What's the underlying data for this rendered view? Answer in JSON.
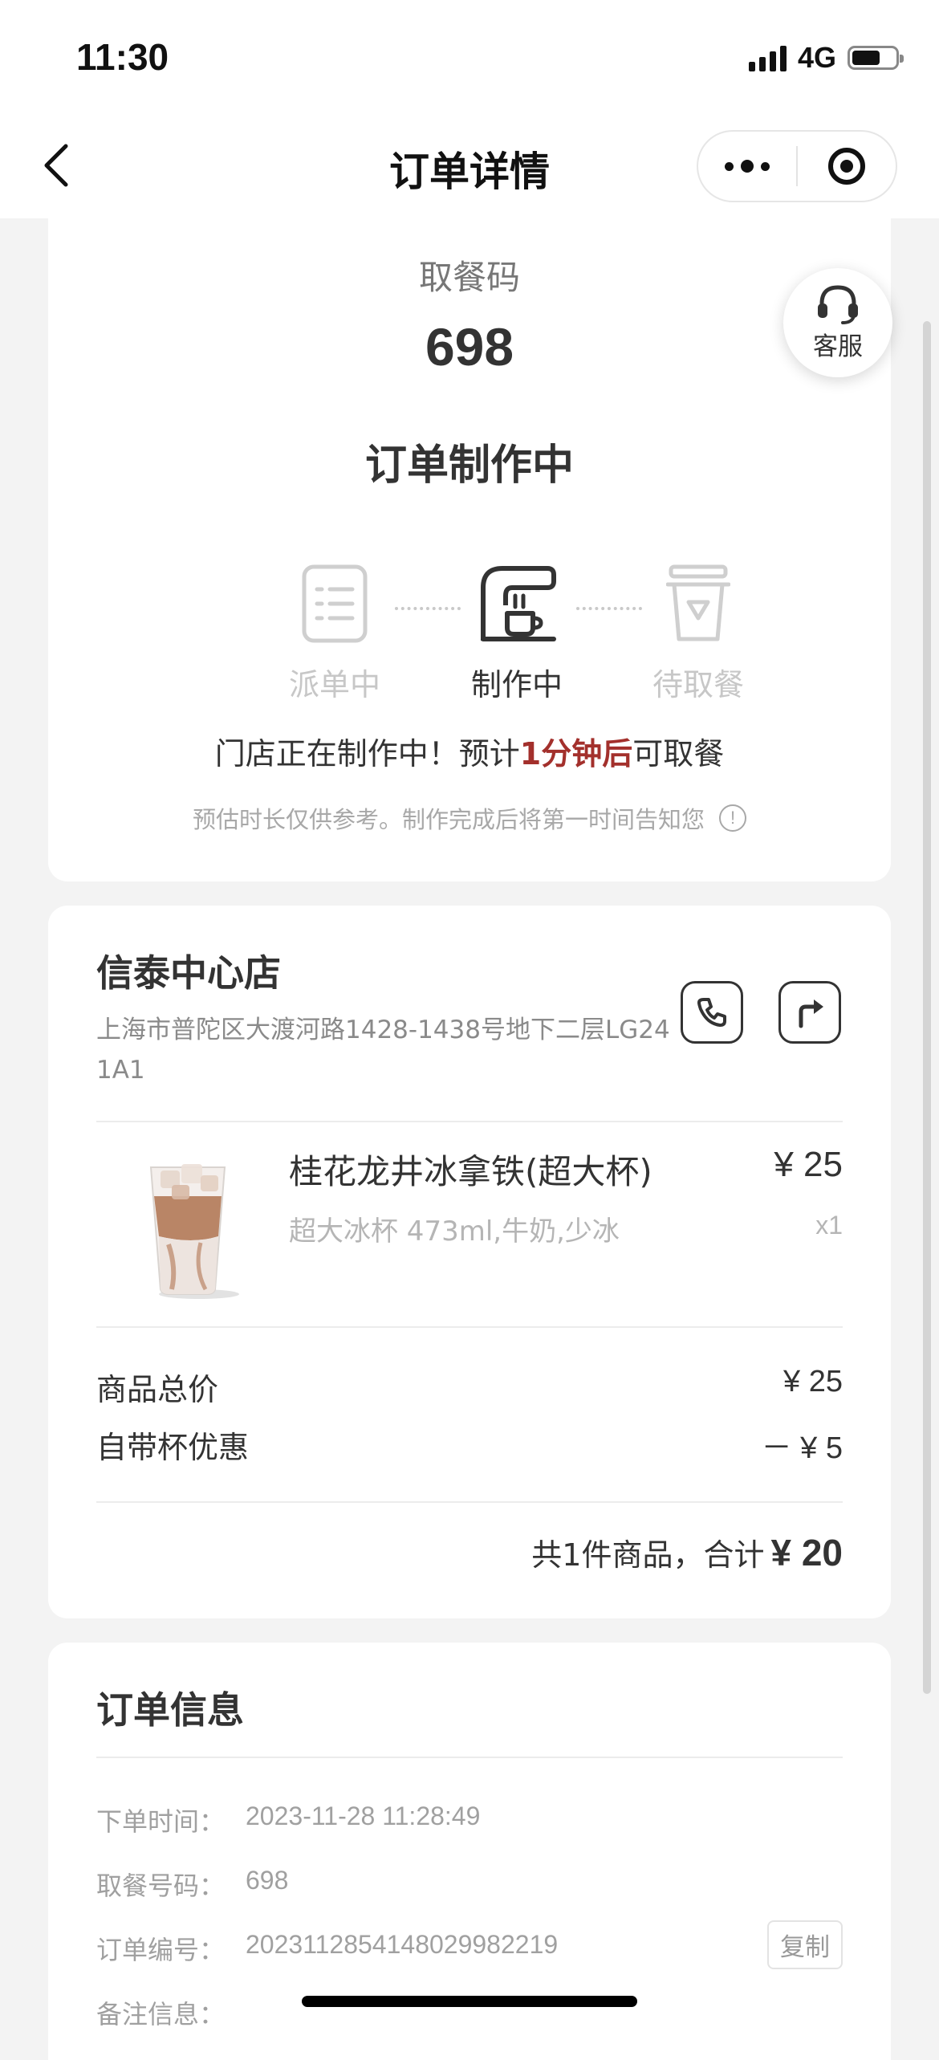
{
  "status_bar": {
    "time": "11:30",
    "network": "4G",
    "battery_level": 0.65
  },
  "nav": {
    "title": "订单详情",
    "icons": {
      "back": "chevron-left-icon",
      "more": "more-dots-icon",
      "close": "target-circle-icon"
    }
  },
  "pickup": {
    "label": "取餐码",
    "code": "698",
    "status": "订单制作中",
    "steps": [
      {
        "label": "派单中",
        "icon": "order-list-icon",
        "active": false
      },
      {
        "label": "制作中",
        "icon": "coffee-machine-icon",
        "active": true
      },
      {
        "label": "待取餐",
        "icon": "cup-icon",
        "active": false
      }
    ],
    "eta_prefix": "门店正在制作中！预计",
    "eta_highlight": "1分钟后",
    "eta_suffix": "可取餐",
    "note": "预估时长仅供参考。制作完成后将第一时间告知您",
    "accent_color": "#a3302c"
  },
  "customer_service": {
    "label": "客服",
    "icon": "headset-icon"
  },
  "store": {
    "name": "信泰中心店",
    "address": "上海市普陀区大渡河路1428-1438号地下二层LG241A1",
    "icons": {
      "phone": "phone-icon",
      "navigate": "navigation-arrow-icon"
    }
  },
  "product": {
    "name": "桂花龙井冰拿铁(超大杯)",
    "price": "¥ 25",
    "spec": "超大冰杯 473ml,牛奶,少冰",
    "qty": "x1"
  },
  "summary": {
    "subtotal_label": "商品总价",
    "subtotal_value": "¥ 25",
    "discount_label": "自带杯优惠",
    "discount_value": "－ ¥ 5",
    "total_prefix": "共1件商品，合计",
    "total_value": "¥ 20"
  },
  "order_info": {
    "title": "订单信息",
    "rows": [
      {
        "key": "下单时间：",
        "value": "2023-11-28 11:28:49"
      },
      {
        "key": "取餐号码：",
        "value": "698"
      },
      {
        "key": "订单编号：",
        "value": "20231128541480299822​19"
      },
      {
        "key": "备注信息：",
        "value": ""
      }
    ],
    "copy_label": "复制"
  }
}
